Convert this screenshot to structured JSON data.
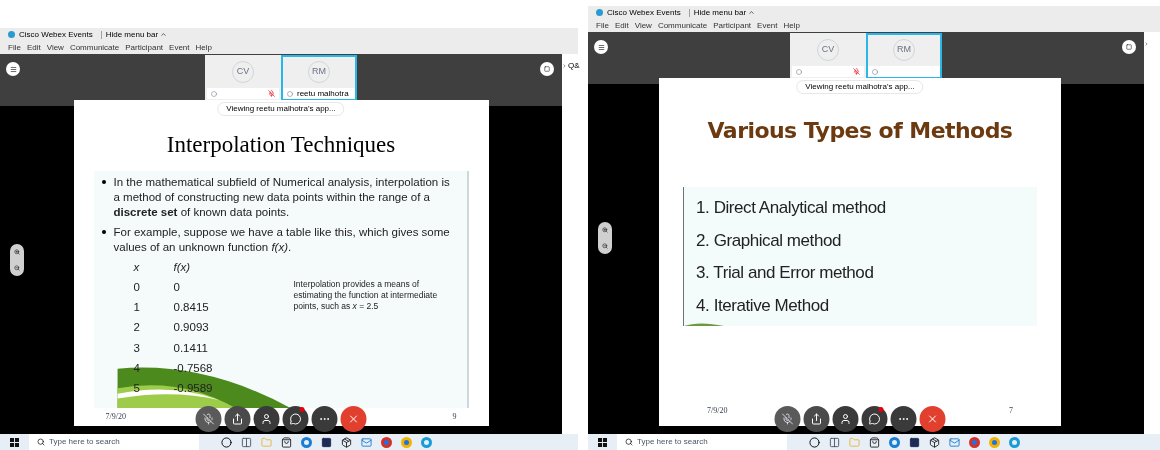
{
  "screens": [
    {
      "app_title": "Cisco Webex Events",
      "menu_toggle": "Hide menu bar",
      "menu": [
        "File",
        "Edit",
        "View",
        "Communicate",
        "Participant",
        "Event",
        "Help"
      ],
      "participants": [
        {
          "initials": "CV",
          "selected": false,
          "muted": true
        },
        {
          "initials": "RM",
          "name": "reetu malhotra",
          "selected": true,
          "muted": false
        }
      ],
      "side_panel_label": "Q&",
      "viewing": "Viewing reetu malhotra's app...",
      "slide": {
        "kind": "bullets",
        "title": "Interpolation Techniques",
        "bullets": [
          "In the mathematical subfield of Numerical analysis, interpolation is a method of constructing new data points within the range of a **discrete set** of known data points.",
          "For example, suppose we have a table like this, which gives some values of an unknown function  *f(x)*."
        ],
        "table": {
          "columns": [
            "*x*",
            "*f(x)*"
          ],
          "rows": [
            [
              "0",
              "0"
            ],
            [
              "1",
              "0.8415"
            ],
            [
              "2",
              "0.9093"
            ],
            [
              "3",
              "0.1411"
            ],
            [
              "4",
              "-0.7568"
            ],
            [
              "5",
              "-0.9589"
            ]
          ]
        },
        "note": "Interpolation provides a means of estimating the function at intermediate points, such as  *x* = 2.5",
        "date": "7/9/20",
        "page": "9"
      },
      "chat_unread": true,
      "taskbar": {
        "search_placeholder": "Type here to search"
      }
    },
    {
      "app_title": "Cisco Webex Events",
      "menu_toggle": "Hide menu bar",
      "menu": [
        "File",
        "Edit",
        "View",
        "Communicate",
        "Participant",
        "Event",
        "Help"
      ],
      "participants": [
        {
          "initials": "CV",
          "selected": false,
          "muted": true
        },
        {
          "initials": "RM",
          "selected": true,
          "muted": false
        }
      ],
      "viewing": "Viewing reetu malhotra's app...",
      "slide": {
        "kind": "list",
        "title": "Various Types of Methods",
        "items": [
          "1. Direct  Analytical method",
          "2. Graphical method",
          "3. Trial and Error method",
          "4. Iterative Method"
        ],
        "date": "7/9/20",
        "page": "7"
      },
      "chat_unread": true,
      "taskbar": {
        "search_placeholder": "Type here to search"
      }
    }
  ]
}
